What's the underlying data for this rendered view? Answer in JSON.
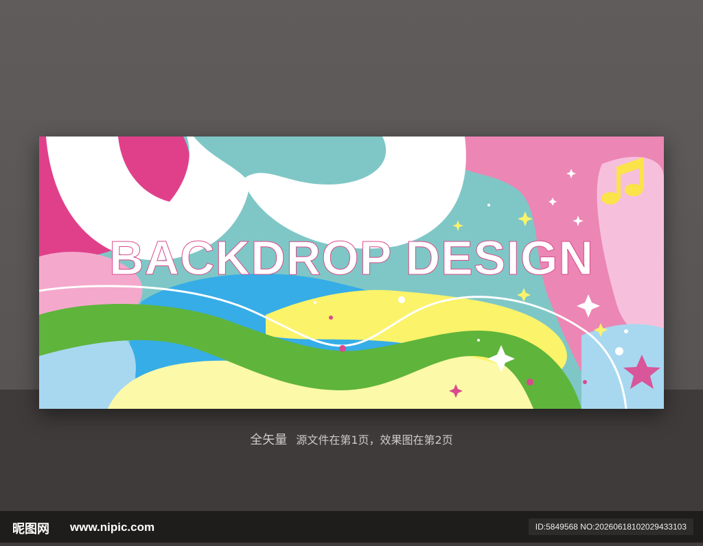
{
  "banner": {
    "title": "BACKDROP DESIGN",
    "colors": {
      "pink": "#e0408a",
      "light_pink": "#f2a3c8",
      "teal": "#7fc7c6",
      "blue": "#3aace6",
      "light_blue": "#a8d8f0",
      "yellow": "#fbf36a",
      "pale_yellow": "#fcf9a8",
      "green": "#5fb43b",
      "white": "#ffffff"
    },
    "music_note_icon": "music-note-icon"
  },
  "caption": {
    "strong": "全矢量",
    "text": "源文件在第1页，效果图在第2页"
  },
  "footer": {
    "logo_cn": "昵图网",
    "logo_url": "www.nipic.com",
    "id_text": "ID:5849568 NO:20260618102029433103"
  }
}
